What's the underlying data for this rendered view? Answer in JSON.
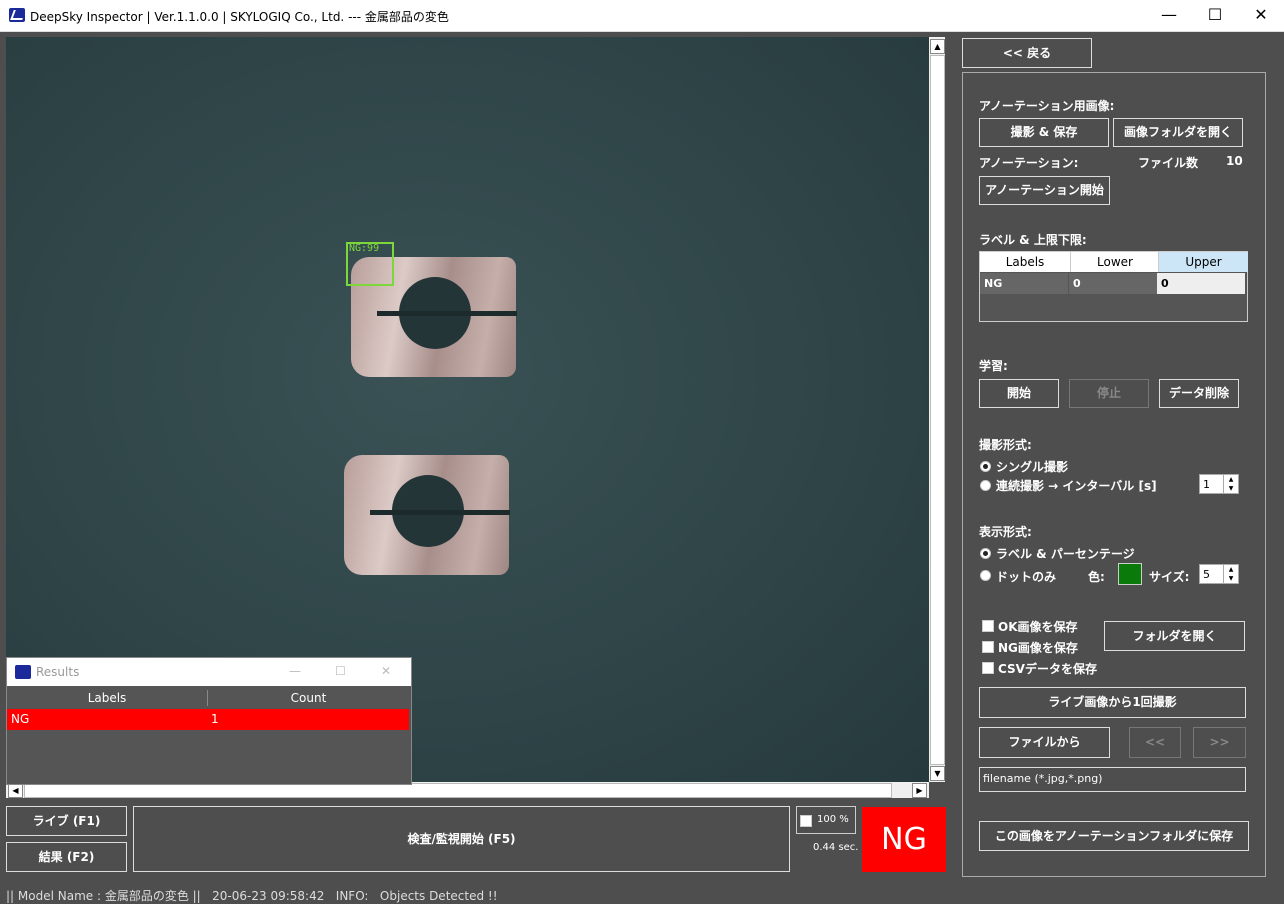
{
  "window": {
    "title": "DeepSky Inspector | Ver.1.1.0.0 | SKYLOGIQ Co., Ltd. --- 金属部品の変色",
    "minimize": "—",
    "maximize": "☐",
    "close": "✕"
  },
  "viewer": {
    "detection_label": "NG:99",
    "scroll_up": "▲",
    "scroll_down": "▼",
    "scroll_left": "◀",
    "scroll_right": "▶"
  },
  "results": {
    "title": "Results",
    "minimize": "—",
    "maximize": "☐",
    "close": "✕",
    "columns": [
      "Labels",
      "Count"
    ],
    "rows": [
      {
        "label": "NG",
        "count": "1"
      }
    ],
    "row_color": "#ff0000"
  },
  "bottom": {
    "live_button": "ライブ (F1)",
    "result_button": "結果 (F2)",
    "inspect_button": "検査/監視開始 (F5)",
    "zoom_value": "100 %",
    "elapsed": "0.44 sec.",
    "verdict": "NG",
    "verdict_color": "#ff0000"
  },
  "status": {
    "text": "|| Model Name : 金属部品の変色 ||   20-06-23 09:58:42   INFO:   Objects Detected !!"
  },
  "panel": {
    "back_button": "<< 戻る",
    "annotation_images_heading": "アノーテーション用画像:",
    "capture_save_button": "撮影 & 保存",
    "open_image_folder_button": "画像フォルダを開く",
    "annotation_heading": "アノーテーション:",
    "file_count_label": "ファイル数",
    "file_count_value": "10",
    "annotation_start_button": "アノーテーション開始",
    "labels_limits_heading": "ラベル & 上限下限:",
    "label_table": {
      "columns": [
        "Labels",
        "Lower",
        "Upper"
      ],
      "rows": [
        {
          "label": "NG",
          "lower": "0",
          "upper": "0"
        }
      ]
    },
    "learning_heading": "学習:",
    "learn_start_button": "開始",
    "learn_stop_button": "停止",
    "delete_data_button": "データ削除",
    "capture_mode_heading": "撮影形式:",
    "single_capture": "シングル撮影",
    "continuous_capture": "連続撮影 → インターバル [s]",
    "interval_value": "1",
    "display_mode_heading": "表示形式:",
    "label_percentage": "ラベル & パーセンテージ",
    "dot_only": "ドットのみ",
    "color_label": "色:",
    "dot_color": "#0a7a0a",
    "size_label": "サイズ:",
    "size_value": "5",
    "save_ok": "OK画像を保存",
    "save_ng": "NG画像を保存",
    "save_csv": "CSVデータを保存",
    "open_folder_button": "フォルダを開く",
    "capture_once_button": "ライブ画像から1回撮影",
    "from_file_button": "ファイルから",
    "prev_button": "<<",
    "next_button": ">>",
    "filename_placeholder": "filename (*.jpg,*.png)",
    "save_to_annotation_button": "この画像をアノーテーションフォルダに保存"
  }
}
